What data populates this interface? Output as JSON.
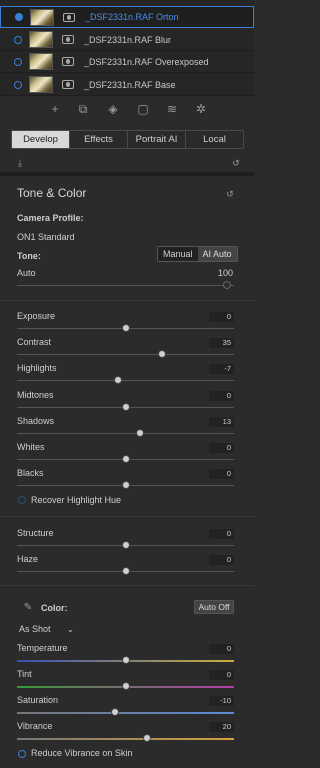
{
  "layers": [
    {
      "name": "_DSF2331n.RAF Orton",
      "selected": true
    },
    {
      "name": "_DSF2331n.RAF Blur",
      "selected": false
    },
    {
      "name": "_DSF2331n.RAF Overexposed",
      "selected": false
    },
    {
      "name": "_DSF2331n.RAF Base",
      "selected": false
    }
  ],
  "layer_tool_icons": [
    "add-layer-icon",
    "copy-layer-icon",
    "paint-bucket-icon",
    "document-icon",
    "stack-layers-icon",
    "settings-gear-icon"
  ],
  "tabs": [
    "Develop",
    "Effects",
    "Portrait AI",
    "Local"
  ],
  "active_tab": "Develop",
  "panel": {
    "title": "Tone & Color",
    "camera_profile_label": "Camera Profile:",
    "camera_profile_value": "ON1 Standard",
    "tone_label": "Tone:",
    "tone_modes": [
      "Manual",
      "AI Auto"
    ],
    "tone_active": "AI Auto",
    "auto_label": "Auto",
    "auto_value": "100",
    "recover_label": "Recover Highlight Hue",
    "color_label": "Color:",
    "auto_off_label": "Auto Off",
    "white_balance": "As Shot",
    "reduce_vibrance_label": "Reduce Vibrance on Skin"
  },
  "tone_sliders": [
    {
      "label": "Exposure",
      "value": "0",
      "level": 0.5
    },
    {
      "label": "Contrast",
      "value": "35",
      "level": 0.67
    },
    {
      "label": "Highlights",
      "value": "-7",
      "level": 0.465
    },
    {
      "label": "Midtones",
      "value": "0",
      "level": 0.5
    },
    {
      "label": "Shadows",
      "value": "13",
      "level": 0.565
    },
    {
      "label": "Whites",
      "value": "0",
      "level": 0.5
    },
    {
      "label": "Blacks",
      "value": "0",
      "level": 0.5
    }
  ],
  "detail_sliders": [
    {
      "label": "Structure",
      "value": "0",
      "level": 0.5
    },
    {
      "label": "Haze",
      "value": "0",
      "level": 0.5
    }
  ],
  "color_sliders": [
    {
      "label": "Temperature",
      "value": "0",
      "level": 0.5
    },
    {
      "label": "Tint",
      "value": "0",
      "level": 0.5
    },
    {
      "label": "Saturation",
      "value": "-10",
      "level": 0.45
    },
    {
      "label": "Vibrance",
      "value": "20",
      "level": 0.6
    }
  ],
  "colors": {
    "accent": "#3a7fd6",
    "background": "#2b2b2b",
    "temperature_gradient": [
      "#3a4fb5",
      "#c8b03a"
    ],
    "tint_gradient": [
      "#3a9a3a",
      "#b53aa8"
    ],
    "saturation_gradient": [
      "#777777",
      "#5a8ad6"
    ],
    "vibrance_gradient": [
      "#777777",
      "#d6a03a"
    ]
  }
}
